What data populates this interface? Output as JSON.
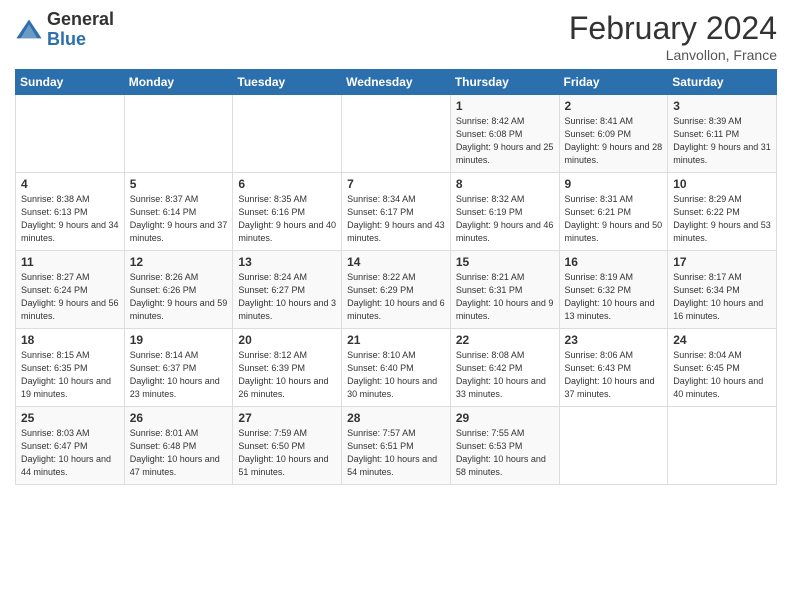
{
  "header": {
    "logo_general": "General",
    "logo_blue": "Blue",
    "month_title": "February 2024",
    "location": "Lanvollon, France"
  },
  "weekdays": [
    "Sunday",
    "Monday",
    "Tuesday",
    "Wednesday",
    "Thursday",
    "Friday",
    "Saturday"
  ],
  "weeks": [
    [
      {
        "day": "",
        "info": ""
      },
      {
        "day": "",
        "info": ""
      },
      {
        "day": "",
        "info": ""
      },
      {
        "day": "",
        "info": ""
      },
      {
        "day": "1",
        "info": "Sunrise: 8:42 AM\nSunset: 6:08 PM\nDaylight: 9 hours and 25 minutes."
      },
      {
        "day": "2",
        "info": "Sunrise: 8:41 AM\nSunset: 6:09 PM\nDaylight: 9 hours and 28 minutes."
      },
      {
        "day": "3",
        "info": "Sunrise: 8:39 AM\nSunset: 6:11 PM\nDaylight: 9 hours and 31 minutes."
      }
    ],
    [
      {
        "day": "4",
        "info": "Sunrise: 8:38 AM\nSunset: 6:13 PM\nDaylight: 9 hours and 34 minutes."
      },
      {
        "day": "5",
        "info": "Sunrise: 8:37 AM\nSunset: 6:14 PM\nDaylight: 9 hours and 37 minutes."
      },
      {
        "day": "6",
        "info": "Sunrise: 8:35 AM\nSunset: 6:16 PM\nDaylight: 9 hours and 40 minutes."
      },
      {
        "day": "7",
        "info": "Sunrise: 8:34 AM\nSunset: 6:17 PM\nDaylight: 9 hours and 43 minutes."
      },
      {
        "day": "8",
        "info": "Sunrise: 8:32 AM\nSunset: 6:19 PM\nDaylight: 9 hours and 46 minutes."
      },
      {
        "day": "9",
        "info": "Sunrise: 8:31 AM\nSunset: 6:21 PM\nDaylight: 9 hours and 50 minutes."
      },
      {
        "day": "10",
        "info": "Sunrise: 8:29 AM\nSunset: 6:22 PM\nDaylight: 9 hours and 53 minutes."
      }
    ],
    [
      {
        "day": "11",
        "info": "Sunrise: 8:27 AM\nSunset: 6:24 PM\nDaylight: 9 hours and 56 minutes."
      },
      {
        "day": "12",
        "info": "Sunrise: 8:26 AM\nSunset: 6:26 PM\nDaylight: 9 hours and 59 minutes."
      },
      {
        "day": "13",
        "info": "Sunrise: 8:24 AM\nSunset: 6:27 PM\nDaylight: 10 hours and 3 minutes."
      },
      {
        "day": "14",
        "info": "Sunrise: 8:22 AM\nSunset: 6:29 PM\nDaylight: 10 hours and 6 minutes."
      },
      {
        "day": "15",
        "info": "Sunrise: 8:21 AM\nSunset: 6:31 PM\nDaylight: 10 hours and 9 minutes."
      },
      {
        "day": "16",
        "info": "Sunrise: 8:19 AM\nSunset: 6:32 PM\nDaylight: 10 hours and 13 minutes."
      },
      {
        "day": "17",
        "info": "Sunrise: 8:17 AM\nSunset: 6:34 PM\nDaylight: 10 hours and 16 minutes."
      }
    ],
    [
      {
        "day": "18",
        "info": "Sunrise: 8:15 AM\nSunset: 6:35 PM\nDaylight: 10 hours and 19 minutes."
      },
      {
        "day": "19",
        "info": "Sunrise: 8:14 AM\nSunset: 6:37 PM\nDaylight: 10 hours and 23 minutes."
      },
      {
        "day": "20",
        "info": "Sunrise: 8:12 AM\nSunset: 6:39 PM\nDaylight: 10 hours and 26 minutes."
      },
      {
        "day": "21",
        "info": "Sunrise: 8:10 AM\nSunset: 6:40 PM\nDaylight: 10 hours and 30 minutes."
      },
      {
        "day": "22",
        "info": "Sunrise: 8:08 AM\nSunset: 6:42 PM\nDaylight: 10 hours and 33 minutes."
      },
      {
        "day": "23",
        "info": "Sunrise: 8:06 AM\nSunset: 6:43 PM\nDaylight: 10 hours and 37 minutes."
      },
      {
        "day": "24",
        "info": "Sunrise: 8:04 AM\nSunset: 6:45 PM\nDaylight: 10 hours and 40 minutes."
      }
    ],
    [
      {
        "day": "25",
        "info": "Sunrise: 8:03 AM\nSunset: 6:47 PM\nDaylight: 10 hours and 44 minutes."
      },
      {
        "day": "26",
        "info": "Sunrise: 8:01 AM\nSunset: 6:48 PM\nDaylight: 10 hours and 47 minutes."
      },
      {
        "day": "27",
        "info": "Sunrise: 7:59 AM\nSunset: 6:50 PM\nDaylight: 10 hours and 51 minutes."
      },
      {
        "day": "28",
        "info": "Sunrise: 7:57 AM\nSunset: 6:51 PM\nDaylight: 10 hours and 54 minutes."
      },
      {
        "day": "29",
        "info": "Sunrise: 7:55 AM\nSunset: 6:53 PM\nDaylight: 10 hours and 58 minutes."
      },
      {
        "day": "",
        "info": ""
      },
      {
        "day": "",
        "info": ""
      }
    ]
  ]
}
